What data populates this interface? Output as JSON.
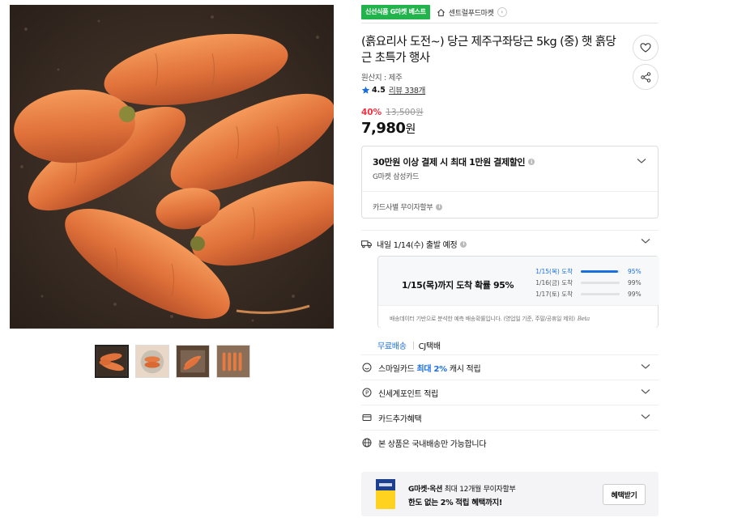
{
  "badge": {
    "label": "신선식품 G마켓 베스트",
    "color": "#22b34c"
  },
  "seller": {
    "name": "센트럴푸드마켓",
    "icon": "home-icon"
  },
  "product": {
    "title": "(흙요리사 도전~) 당근 제주구좌당근 5kg (중) 햇 흙당근 초특가 행사",
    "origin": "원산지 : 제주",
    "rating": "4.5",
    "review_text": "리뷰 338개"
  },
  "price": {
    "discount": "40%",
    "original": "13,500원",
    "current": "7,980",
    "unit": "원",
    "discount_color": "#f43142"
  },
  "card_benefit": {
    "title": "30만원 이상 결제 시 최대 1만원 결제할인",
    "sub": "G마켓 삼성카드",
    "installment": "카드사별 무이자할부"
  },
  "shipping": {
    "departure": "내일 1/14(수) 출발 예정",
    "arrival_prob": "1/15(목)까지 도착 확률 95%",
    "probs": [
      {
        "date": "1/15(목) 도착",
        "percent": "95%",
        "value": 95
      },
      {
        "date": "1/16(금) 도착",
        "percent": "99%",
        "value": 99
      },
      {
        "date": "1/17(토) 도착",
        "percent": "99%",
        "value": 99
      }
    ],
    "note": "배송데이터 기반으로 분석한 예측 배송확률입니다. (영업일 기준, 주말/공휴일 제외)",
    "beta": "Beta",
    "free": "무료배송",
    "carrier": "CJ택배",
    "accent": "#1a6fe0"
  },
  "options": {
    "smile_pre": "스마일카드",
    "smile_hl": "최대 2%",
    "smile_post": "캐시 적립",
    "shinsegae": "신세계포인트 적립",
    "card_extra": "카드추가혜택",
    "domestic": "본 상품은 국내배송만 가능합니다"
  },
  "promo": {
    "brand": "G마켓·옥션",
    "line1_rest": "최대 12개월 무이자할부",
    "line2": "한도 없는 2% 적립 혜택까지!",
    "button": "혜택받기"
  }
}
